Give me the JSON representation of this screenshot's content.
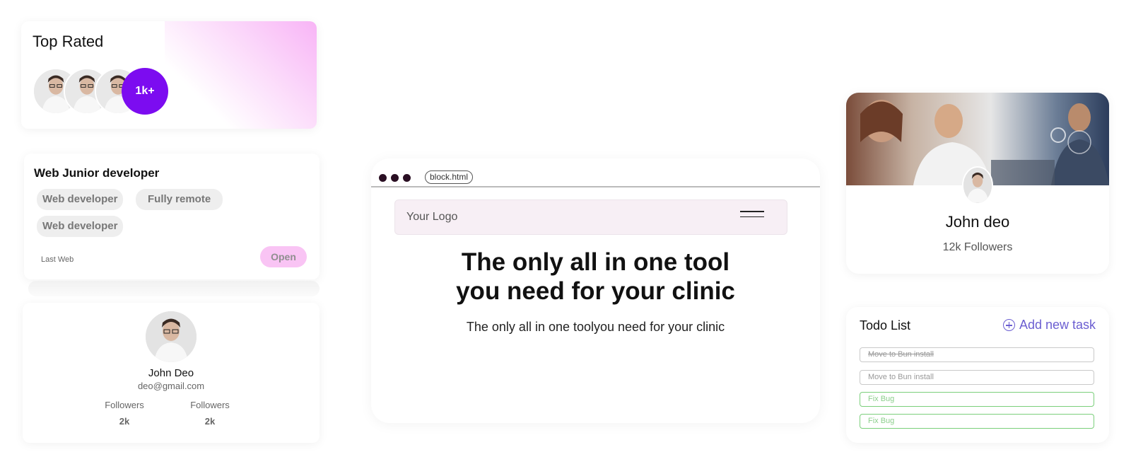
{
  "top_rated": {
    "title": "Top Rated",
    "count_badge": "1k+"
  },
  "job_card": {
    "title": "Web Junior developer",
    "tags": [
      "Web developer",
      "Fully remote",
      "Web developer"
    ],
    "meta": "Last Web",
    "action_label": "Open"
  },
  "profile_card": {
    "name": "John Deo",
    "email": "deo@gmail.com",
    "stats": [
      {
        "label": "Followers",
        "value": "2k"
      },
      {
        "label": "Followers",
        "value": "2k"
      }
    ]
  },
  "browser": {
    "url": "block.html",
    "logo": "Your Logo",
    "hero_title_line1": "The only all in one tool",
    "hero_title_line2": "you need for your clinic",
    "hero_subtitle": "The only all in one toolyou need for your clinic"
  },
  "social_card": {
    "name": "John deo",
    "followers": "12k Followers"
  },
  "todo": {
    "title": "Todo List",
    "add_label": "Add new task",
    "tasks": [
      {
        "label": "Move to Bun install",
        "status": "done"
      },
      {
        "label": "Move to Bun install",
        "status": "pending"
      },
      {
        "label": "Fix Bug",
        "status": "active"
      },
      {
        "label": "Fix Bug",
        "status": "active"
      }
    ]
  },
  "colors": {
    "accent_purple": "#7c0cf0",
    "open_pink": "#f9c4f4",
    "add_task": "#6b5ed1",
    "task_green": "#7bcf7b"
  },
  "icons": [
    "avatar",
    "menu-icon",
    "plus-circle-icon",
    "browser-dot-icon"
  ]
}
